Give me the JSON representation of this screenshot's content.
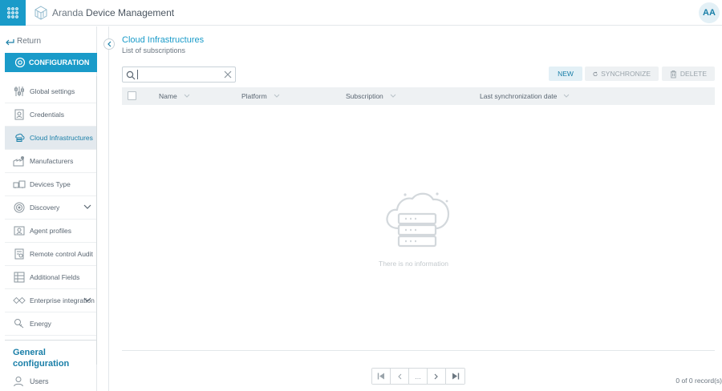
{
  "header": {
    "app_name_light": "Aranda",
    "app_name_bold": "Device Management",
    "avatar_initials": "AA"
  },
  "sidebar": {
    "return_label": "Return",
    "configuration_label": "CONFIGURATION",
    "items": [
      {
        "label": "Global settings",
        "icon": "sliders-icon"
      },
      {
        "label": "Credentials",
        "icon": "id-card-icon"
      },
      {
        "label": "Cloud Infrastructures",
        "icon": "cloud-server-icon",
        "active": true
      },
      {
        "label": "Manufacturers",
        "icon": "factory-icon"
      },
      {
        "label": "Devices Type",
        "icon": "devices-icon"
      },
      {
        "label": "Discovery",
        "icon": "radar-icon",
        "expandable": true
      },
      {
        "label": "Agent profiles",
        "icon": "agent-icon"
      },
      {
        "label": "Remote control Audit",
        "icon": "remote-icon"
      },
      {
        "label": "Additional Fields",
        "icon": "fields-icon"
      },
      {
        "label": "Enterprise integration",
        "icon": "handshake-icon",
        "expandable": true
      },
      {
        "label": "Energy",
        "icon": "energy-icon"
      }
    ],
    "general_heading": "General configuration",
    "users_label": "Users"
  },
  "main": {
    "title": "Cloud Infrastructures",
    "subtitle": "List of subscriptions",
    "search": {
      "value": "",
      "placeholder": ""
    },
    "actions": {
      "new": "NEW",
      "synchronize": "SYNCHRONIZE",
      "delete": "DELETE"
    },
    "columns": [
      "Name",
      "Platform",
      "Subscription",
      "Last synchronization date"
    ],
    "empty_message": "There is no information",
    "pager": {
      "middle": "..."
    },
    "records_text": "0 of 0 record(s)"
  },
  "colors": {
    "accent": "#1a9bc9",
    "active_bg": "#e3e9ee"
  }
}
